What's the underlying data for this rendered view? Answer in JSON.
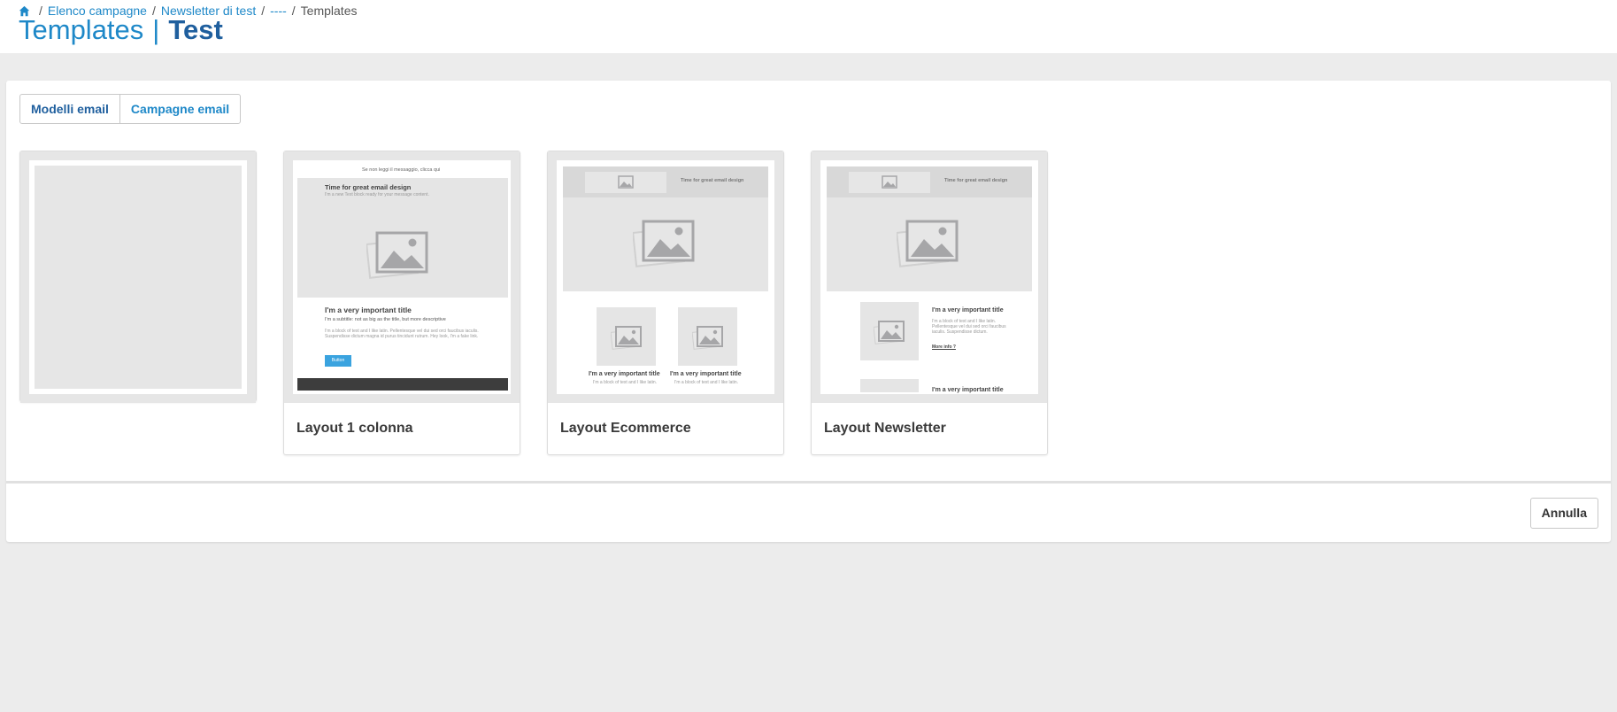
{
  "breadcrumb": {
    "items": [
      "Elenco campagne",
      "Newsletter di test",
      "----"
    ],
    "current": "Templates"
  },
  "page_title": {
    "main": "Templates",
    "separator": "|",
    "sub": "Test"
  },
  "tabs": [
    {
      "label": "Modelli email",
      "active": true
    },
    {
      "label": "Campagne email",
      "active": false
    }
  ],
  "templates": [
    {
      "label": ""
    },
    {
      "label": "Layout 1 colonna",
      "preview": {
        "top_link": "Se non leggi il messaggio, clicca qui",
        "hero_title": "Time for great email design",
        "hero_sub": "I'm a new Text block ready for your message content.",
        "title": "I'm a very important title",
        "subtitle": "I'm a subtitle: not as big as the title, but more descriptive",
        "body": "I'm a block of text and I like latin. Pellentesque vel dui sed orci faucibus iaculis. Suspendisse dictum magna id purus tincidunt rutrum. Hey look, I'm a fake link.",
        "button": "Button"
      }
    },
    {
      "label": "Layout Ecommerce",
      "preview": {
        "header": "Time for great email design",
        "item_title": "I'm a very important title",
        "item_text": "I'm a block of text and I like latin."
      }
    },
    {
      "label": "Layout Newsletter",
      "preview": {
        "header": "Time for great email design",
        "title": "I'm a very important title",
        "text": "I'm a block of text and I like latin. Pellentesque vel dui sed orci faucibus iaculis. Suspendisse dictum.",
        "link": "More info ?",
        "title2": "I'm a very important title"
      }
    }
  ],
  "footer": {
    "cancel_label": "Annulla"
  },
  "colors": {
    "accent": "#1e88c8",
    "title_bold": "#1f5f9e",
    "background": "#ececec"
  }
}
